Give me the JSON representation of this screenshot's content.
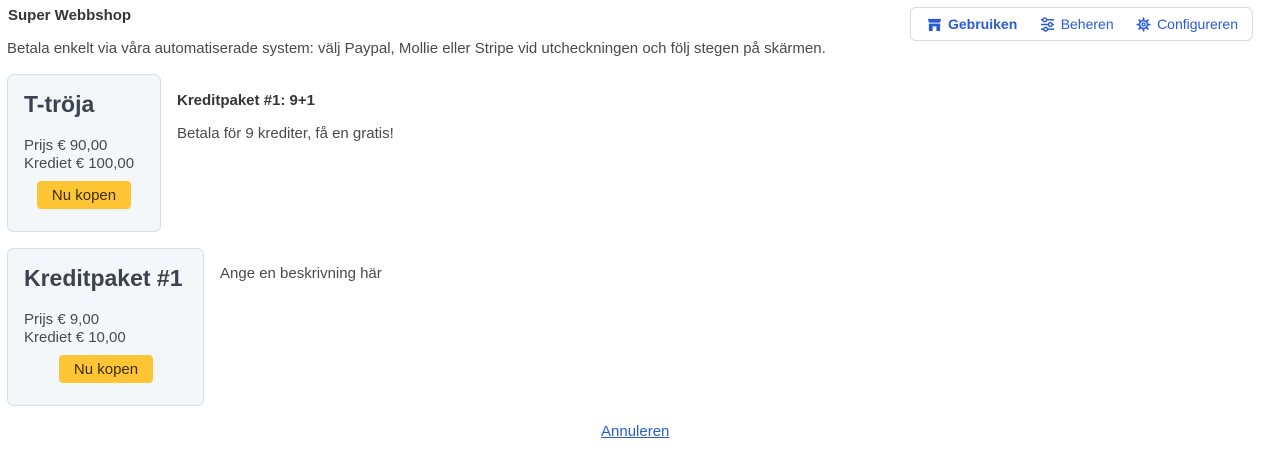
{
  "app": {
    "title": "Super Webbshop"
  },
  "intro": "Betala enkelt via våra automatiserade system: välj Paypal, Mollie eller Stripe vid utcheckningen och följ stegen på skärmen.",
  "toolbar": {
    "items": [
      {
        "label": "Gebruiken",
        "icon": "store-icon",
        "active": true
      },
      {
        "label": "Beheren",
        "icon": "sliders-icon",
        "active": false
      },
      {
        "label": "Configureren",
        "icon": "gear-icon",
        "active": false
      }
    ]
  },
  "products": [
    {
      "title": "T-tröja",
      "price": "Prijs € 90,00",
      "credit": "Krediet € 100,00",
      "buy_label": "Nu kopen",
      "desc_title": "Kreditpaket #1: 9+1",
      "desc_text": "Betala för 9 krediter, få en gratis!"
    },
    {
      "title": "Kreditpaket #1",
      "price": "Prijs € 9,00",
      "credit": "Krediet € 10,00",
      "buy_label": "Nu kopen",
      "desc_text": "Ange en beskrivning här"
    }
  ],
  "cancel_label": "Annuleren",
  "colors": {
    "accent": "#2a5bd7",
    "button": "#ffc534",
    "card_bg": "#f3f7fa"
  }
}
